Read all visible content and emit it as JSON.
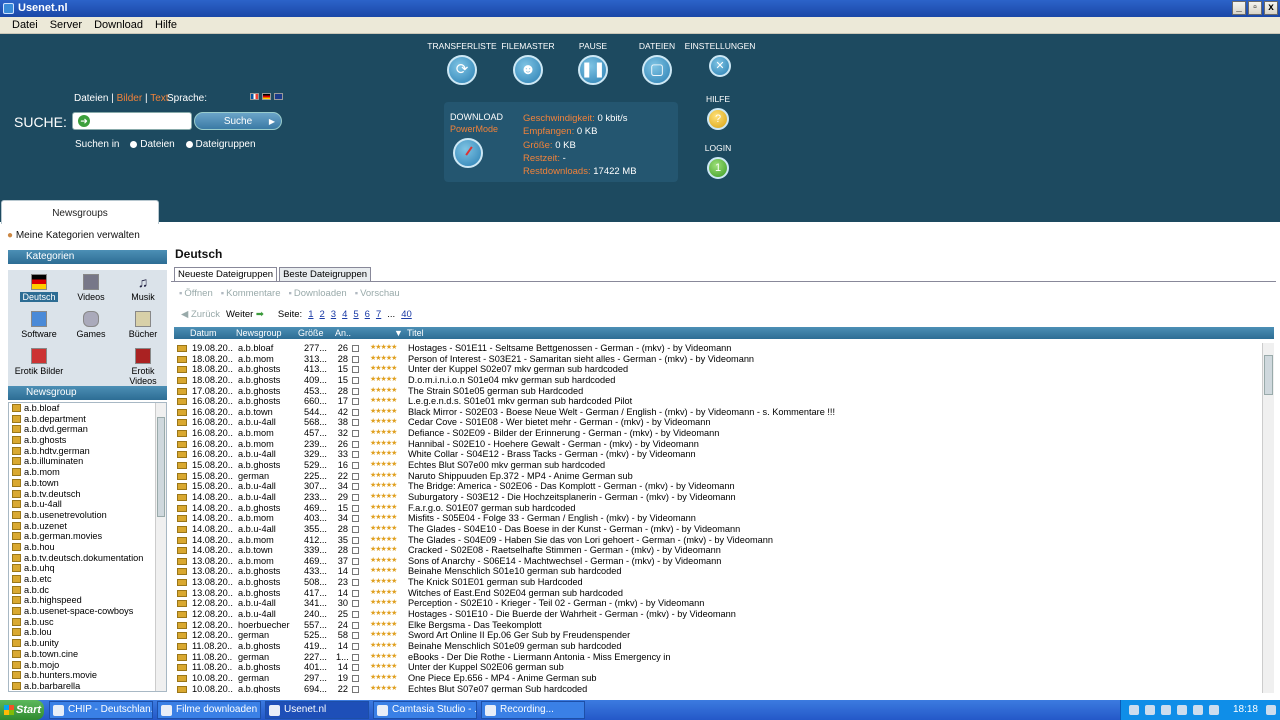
{
  "window": {
    "title": "Usenet.nl",
    "min": "_",
    "max": "▫",
    "close": "x"
  },
  "menu": [
    "Datei",
    "Server",
    "Download",
    "Hilfe"
  ],
  "search": {
    "label": "SUCHE:",
    "types": [
      "Dateien",
      "Bilder",
      "Text"
    ],
    "language_label": "Sprache:",
    "button": "Suche",
    "search_in": "Suchen in",
    "options": [
      "Dateien",
      "Dateigruppen"
    ],
    "value": ""
  },
  "toolbar_top": {
    "transferliste": "TRANSFERLISTE",
    "filemaster": "FILEMASTER",
    "pause": "PAUSE",
    "dateien": "DATEIEN",
    "einstellungen": "EINSTELLUNGEN",
    "hilfe": "HILFE",
    "login": "LOGIN"
  },
  "status": {
    "download": "DOWNLOAD",
    "powermode": "PowerMode",
    "geschwindigkeit_k": "Geschwindigkeit:",
    "geschwindigkeit_v": "0 kbit/s",
    "empfangen_k": "Empfangen:",
    "empfangen_v": "0 KB",
    "groesse_k": "Größe:",
    "groesse_v": "0 KB",
    "restzeit_k": "Restzeit:",
    "restzeit_v": "-",
    "restdownloads_k": "Restdownloads:",
    "restdownloads_v": "17422 MB"
  },
  "tabs": {
    "newsgroups": "Newsgroups"
  },
  "left": {
    "my_categories": "Meine Kategorien verwalten",
    "kategorien": "Kategorien",
    "categories": [
      "Deutsch",
      "Videos",
      "Musik",
      "Software",
      "Games",
      "Bücher",
      "Erotik Bilder",
      "Erotik Videos"
    ],
    "newsgroup_head": "Newsgroup",
    "newsgroups": [
      "a.b.bloaf",
      "a.b.department",
      "a.b.dvd.german",
      "a.b.ghosts",
      "a.b.hdtv.german",
      "a.b.illuminaten",
      "a.b.mom",
      "a.b.town",
      "a.b.tv.deutsch",
      "a.b.u-4all",
      "a.b.usenetrevolution",
      "a.b.uzenet",
      "a.b.german.movies",
      "a.b.hou",
      "a.b.tv.deutsch.dokumentation",
      "a.b.uhq",
      "a.b.etc",
      "a.b.dc",
      "a.b.highspeed",
      "a.b.usenet-space-cowboys",
      "a.b.usc",
      "a.b.lou",
      "a.b.unity",
      "a.b.town.cine",
      "a.b.mojo",
      "a.b.hunters.movie",
      "a.b.barbarella"
    ]
  },
  "main": {
    "title": "Deutsch",
    "subtabs": [
      "Neueste Dateigruppen",
      "Beste Dateigruppen"
    ],
    "actions": [
      "Öffnen",
      "Kommentare",
      "Downloaden",
      "Vorschau"
    ],
    "pager": {
      "back": "Zurück",
      "next": "Weiter",
      "page_label": "Seite:",
      "pages": [
        "1",
        "2",
        "3",
        "4",
        "5",
        "6",
        "7",
        "...",
        "40"
      ]
    },
    "columns": [
      "Datum",
      "Newsgroup",
      "Größe",
      "An..",
      "Titel"
    ],
    "rows": [
      [
        "19.08.20..",
        "a.b.bloaf",
        "277...",
        "26",
        "Hostages - S01E11 - Seltsame Bettgenossen - German - (mkv) - by Videomann"
      ],
      [
        "18.08.20..",
        "a.b.mom",
        "313...",
        "28",
        "Person of Interest - S03E21 - Samaritan sieht alles - German - (mkv) - by Videomann"
      ],
      [
        "18.08.20..",
        "a.b.ghosts",
        "413...",
        "15",
        "Unter der Kuppel S02e07 mkv german sub hardcoded"
      ],
      [
        "18.08.20..",
        "a.b.ghosts",
        "409...",
        "15",
        "D.o.m.i.n.i.o.n S01e04 mkv german sub hardcoded"
      ],
      [
        "17.08.20..",
        "a.b.ghosts",
        "453...",
        "28",
        "The Strain S01e05 german sub Hardcoded"
      ],
      [
        "16.08.20..",
        "a.b.ghosts",
        "660...",
        "17",
        "L.e.g.e.n.d.s. S01e01 mkv german sub hardcoded Pilot"
      ],
      [
        "16.08.20..",
        "a.b.town",
        "544...",
        "42",
        "Black Mirror - S02E03 - Boese Neue Welt - German / English - (mkv) - by Videomann - s. Kommentare !!!"
      ],
      [
        "16.08.20..",
        "a.b.u-4all",
        "568...",
        "38",
        "Cedar Cove - S01E08 - Wer bietet mehr - German - (mkv) - by Videomann"
      ],
      [
        "16.08.20..",
        "a.b.mom",
        "457...",
        "32",
        "Defiance - S02E09 - Bilder der Erinnerung - German - (mkv) - by Videomann"
      ],
      [
        "16.08.20..",
        "a.b.mom",
        "239...",
        "26",
        "Hannibal - S02E10 - Hoehere Gewalt - German - (mkv) - by Videomann"
      ],
      [
        "16.08.20..",
        "a.b.u-4all",
        "329...",
        "33",
        "White Collar - S04E12 - Brass Tacks - German - (mkv) - by Videomann"
      ],
      [
        "15.08.20..",
        "a.b.ghosts",
        "529...",
        "16",
        "Echtes Blut S07e00 mkv german sub hardcoded"
      ],
      [
        "15.08.20..",
        "german",
        "225...",
        "22",
        "Naruto Shippuuden Ep.372 - MP4 - Anime German sub"
      ],
      [
        "15.08.20..",
        "a.b.u-4all",
        "307...",
        "34",
        "The Bridge: America - S02E06 - Das Komplott - German - (mkv) - by Videomann"
      ],
      [
        "14.08.20..",
        "a.b.u-4all",
        "233...",
        "29",
        "Suburgatory - S03E12 - Die Hochzeitsplanerin - German - (mkv) - by Videomann"
      ],
      [
        "14.08.20..",
        "a.b.ghosts",
        "469...",
        "15",
        "F.a.r.g.o. S01E07 german sub hardcoded"
      ],
      [
        "14.08.20..",
        "a.b.mom",
        "403...",
        "34",
        "Misfits - S05E04 - Folge 33 - German / English - (mkv) - by Videomann"
      ],
      [
        "14.08.20..",
        "a.b.u-4all",
        "355...",
        "28",
        "The Glades - S04E10 - Das Boese in der Kunst - German - (mkv) - by Videomann"
      ],
      [
        "14.08.20..",
        "a.b.mom",
        "412...",
        "35",
        "The Glades - S04E09 - Haben Sie das von Lori gehoert - German - (mkv) - by Videomann"
      ],
      [
        "14.08.20..",
        "a.b.town",
        "339...",
        "28",
        "Cracked - S02E08 - Raetselhafte Stimmen - German - (mkv) - by Videomann"
      ],
      [
        "13.08.20..",
        "a.b.mom",
        "469...",
        "37",
        "Sons of Anarchy - S06E14 - Machtwechsel - German - (mkv) - by Videomann"
      ],
      [
        "13.08.20..",
        "a.b.ghosts",
        "433...",
        "14",
        "Beinahe Menschlich S01e10 german sub hardcoded"
      ],
      [
        "13.08.20..",
        "a.b.ghosts",
        "508...",
        "23",
        "The Knick S01E01 german sub Hardcoded"
      ],
      [
        "13.08.20..",
        "a.b.ghosts",
        "417...",
        "14",
        "Witches of East.End S02E04 german sub hardcoded"
      ],
      [
        "12.08.20..",
        "a.b.u-4all",
        "341...",
        "30",
        "Perception - S02E10 - Krieger - Teil 02 - German - (mkv) - by Videomann"
      ],
      [
        "12.08.20..",
        "a.b.u-4all",
        "240...",
        "25",
        "Hostages - S01E10 - Die Buerde der Wahrheit - German - (mkv) - by Videomann"
      ],
      [
        "12.08.20..",
        "hoerbuecher",
        "557...",
        "24",
        "Elke Bergsma - Das Teekomplott"
      ],
      [
        "12.08.20..",
        "german",
        "525...",
        "58",
        "Sword Art Online II Ep.06 Ger Sub by Freudenspender"
      ],
      [
        "11.08.20..",
        "a.b.ghosts",
        "419...",
        "14",
        "Beinahe Menschlich S01e09 german sub hardcoded"
      ],
      [
        "11.08.20..",
        "german",
        "227...",
        "1...",
        "eBooks - Der Die Rothe - Liermann Antonia - Miss Emergency in"
      ],
      [
        "11.08.20..",
        "a.b.ghosts",
        "401...",
        "14",
        "Unter der Kuppel S02E06 german sub"
      ],
      [
        "10.08.20..",
        "german",
        "297...",
        "19",
        "One Piece Ep.656 - MP4 - Anime German sub"
      ],
      [
        "10.08.20..",
        "a.b.ghosts",
        "694...",
        "22",
        "Echtes Blut S07e07 german Sub hardcoded"
      ]
    ]
  },
  "taskbar": {
    "start": "Start",
    "tasks": [
      "CHIP - Deutschlan...",
      "Filme downloaden i...",
      "Usenet.nl",
      "Camtasia Studio - ...",
      "Recording..."
    ],
    "clock": "18:18"
  }
}
